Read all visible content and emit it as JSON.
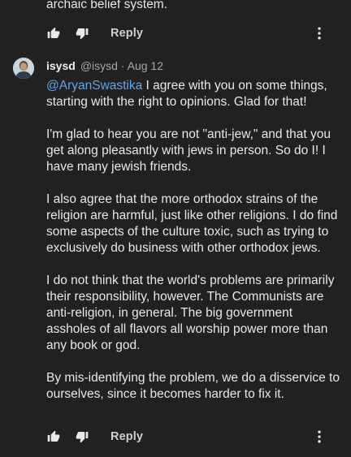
{
  "previous_comment": {
    "tail_text": "archaic belief system.",
    "actions": {
      "reply_label": "Reply"
    }
  },
  "comment": {
    "author": "isysd",
    "handle": "@isysd",
    "separator": "·",
    "date": "Aug 12",
    "mention": "@AryanSwastika",
    "paragraph_1_rest": " I agree with you on some things, starting with the right to opinions. Glad for that!",
    "paragraph_2": "I'm glad to hear you are not \"anti-jew,\" and that you get along pleasantly with jews in person. So do I! I have many jewish friends.",
    "paragraph_3": "I also agree that the more orthodox strains of the religion are harmful, just like other religions. I do find some aspects of the culture toxic, such as trying to exclusively do business with other orthodox jews.",
    "paragraph_4": "I do not think that the world's problems are primarily their responsibility, however. The Communists are anti-religion, in general. The big government assholes of all flavors all worship power more than any book or god.",
    "paragraph_5": "By mis-identifying the problem, we do a disservice to ourselves, since it becomes harder to fix it.",
    "actions": {
      "reply_label": "Reply"
    }
  },
  "icons": {
    "like": "thumbs-up-icon",
    "dislike": "thumbs-down-icon",
    "more": "more-vertical-icon"
  },
  "colors": {
    "background": "#212121",
    "text": "#e8e8e8",
    "muted": "#a8a8a8",
    "mention": "#5fa6e8"
  }
}
